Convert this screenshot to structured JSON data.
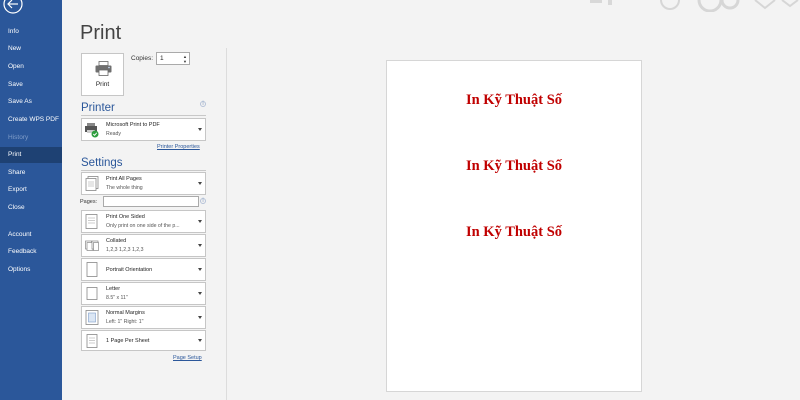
{
  "nav": {
    "items": [
      {
        "label": "Info",
        "state": "normal"
      },
      {
        "label": "New",
        "state": "normal"
      },
      {
        "label": "Open",
        "state": "normal"
      },
      {
        "label": "Save",
        "state": "normal"
      },
      {
        "label": "Save As",
        "state": "normal"
      },
      {
        "label": "Create WPS PDF",
        "state": "normal"
      },
      {
        "label": "History",
        "state": "disabled"
      },
      {
        "label": "Print",
        "state": "active"
      },
      {
        "label": "Share",
        "state": "normal"
      },
      {
        "label": "Export",
        "state": "normal"
      },
      {
        "label": "Close",
        "state": "normal"
      },
      {
        "label": "Account",
        "state": "normal"
      },
      {
        "label": "Feedback",
        "state": "normal"
      },
      {
        "label": "Options",
        "state": "normal"
      }
    ]
  },
  "page": {
    "title": "Print"
  },
  "print_button": {
    "label": "Print",
    "icon": "printer-icon"
  },
  "copies": {
    "label": "Copies:",
    "value": "1"
  },
  "printer": {
    "heading": "Printer",
    "name": "Microsoft Print to PDF",
    "status": "Ready",
    "properties_link": "Printer Properties"
  },
  "settings": {
    "heading": "Settings",
    "pages_label": "Pages:",
    "pages_value": "",
    "options": [
      {
        "line1": "Print All Pages",
        "line2": "The whole thing",
        "icon": "pages-icon"
      },
      {
        "line1": "Print One Sided",
        "line2": "Only print on one side of the p...",
        "icon": "one-sided-icon"
      },
      {
        "line1": "Collated",
        "line2": "1,2,3    1,2,3    1,2,3",
        "icon": "collated-icon"
      },
      {
        "line1": "Portrait Orientation",
        "line2": "",
        "icon": "portrait-icon"
      },
      {
        "line1": "Letter",
        "line2": "8.5\" x 11\"",
        "icon": "paper-size-icon"
      },
      {
        "line1": "Normal Margins",
        "line2": "Left:  1\"    Right:  1\"",
        "icon": "margins-icon"
      },
      {
        "line1": "1 Page Per Sheet",
        "line2": "",
        "icon": "pages-per-sheet-icon"
      }
    ],
    "page_setup_link": "Page Setup"
  },
  "preview": {
    "lines": [
      "In Kỹ Thuật Số",
      "In Kỹ Thuật Số",
      "In Kỹ Thuật Số"
    ],
    "text_color": "#c00000"
  },
  "colors": {
    "nav_bg": "#2b579a",
    "nav_active": "#1e4173",
    "accent": "#2b579a"
  }
}
